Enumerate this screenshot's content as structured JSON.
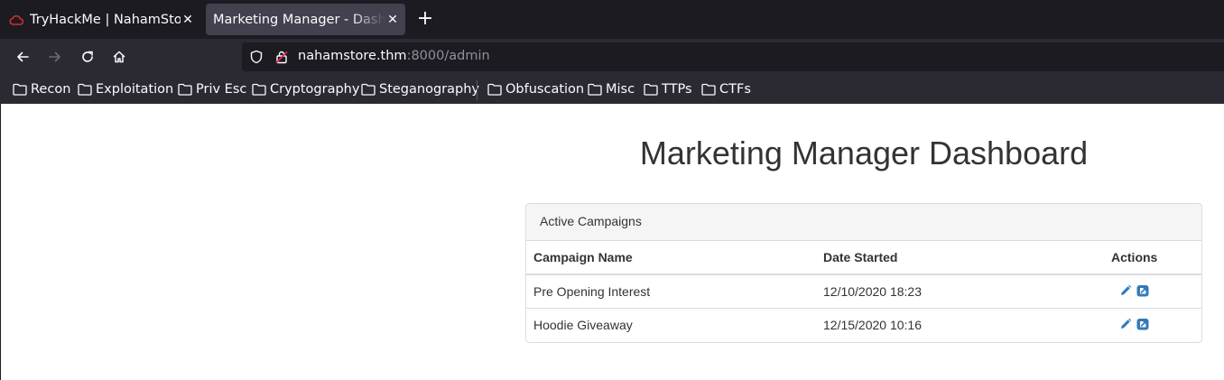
{
  "browser": {
    "tabs": [
      {
        "title": "TryHackMe | NahamStore",
        "icon": "tryhackme-cloud-icon",
        "active": false
      },
      {
        "title": "Marketing Manager - Dashboard",
        "active": true
      }
    ],
    "url": {
      "host": "nahamstore.thm",
      "rest": ":8000/admin"
    },
    "bookmarks": [
      "Recon",
      "Exploitation",
      "Priv Esc",
      "Cryptography",
      "Steganography",
      "Obfuscation",
      "Misc",
      "TTPs",
      "CTFs"
    ],
    "colors": {
      "chrome_dark": "#1c1b22",
      "toolbar": "#2b2a33",
      "active_tab": "#42414d",
      "favicon_red": "#d32f2f"
    }
  },
  "page": {
    "heading": "Marketing Manager Dashboard",
    "panel": {
      "title": "Active Campaigns",
      "columns": [
        "Campaign Name",
        "Date Started",
        "Actions"
      ],
      "rows": [
        {
          "name": "Pre Opening Interest",
          "date": "12/10/2020 18:23",
          "actions": [
            "edit-icon",
            "external-link-icon"
          ]
        },
        {
          "name": "Hoodie Giveaway",
          "date": "12/15/2020 10:16",
          "actions": [
            "edit-icon",
            "external-link-icon"
          ]
        }
      ]
    },
    "colors": {
      "link_blue": "#337ab7",
      "text": "#333333",
      "panel_heading_bg": "#f5f5f5",
      "border": "#dddddd"
    }
  }
}
